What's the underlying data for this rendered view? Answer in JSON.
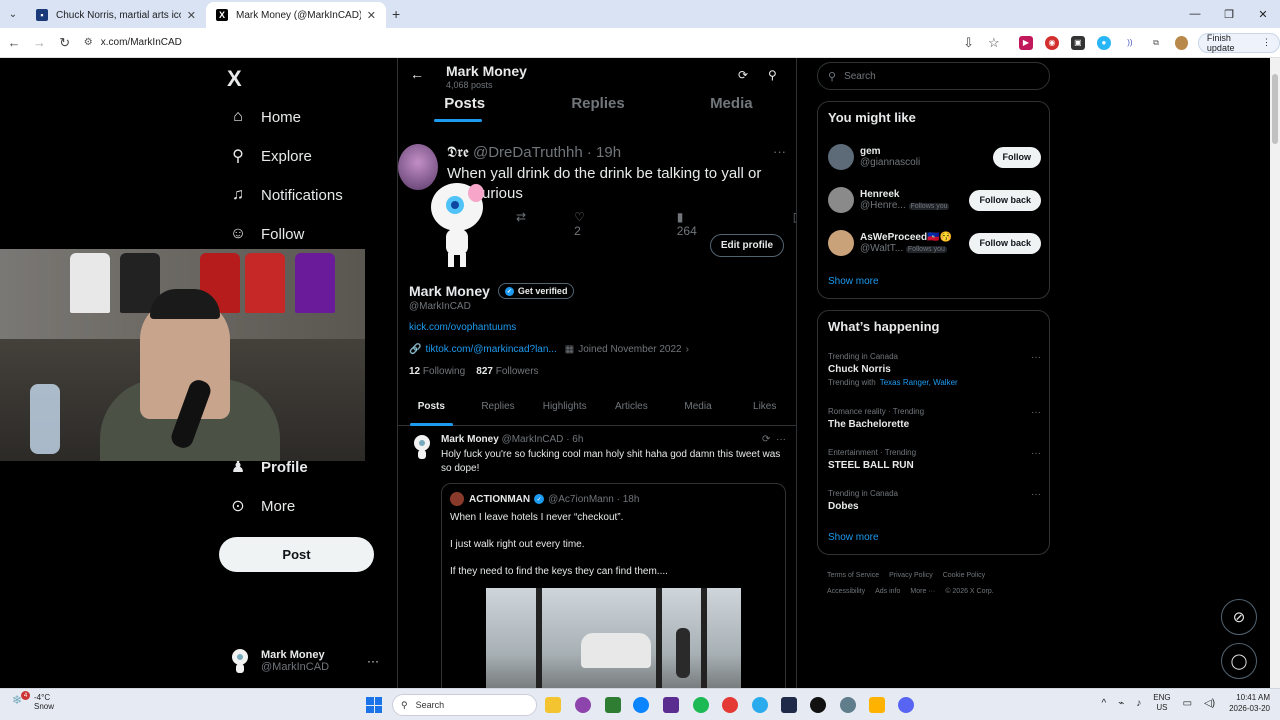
{
  "browser": {
    "tabs": [
      {
        "title": "Chuck Norris, martial arts icon a",
        "active": false
      },
      {
        "title": "Mark Money (@MarkInCAD) / X",
        "active": true
      }
    ],
    "url": "x.com/MarkInCAD",
    "finish_update": "Finish update"
  },
  "sidebar": {
    "logo": "X",
    "items": [
      {
        "label": "Home",
        "icon": "home-icon"
      },
      {
        "label": "Explore",
        "icon": "search-icon"
      },
      {
        "label": "Notifications",
        "icon": "bell-icon"
      },
      {
        "label": "Follow",
        "icon": "add-user-icon"
      },
      {
        "label": "Profile",
        "icon": "person-icon"
      },
      {
        "label": "More",
        "icon": "more-circle-icon"
      }
    ],
    "post_button": "Post",
    "account": {
      "name": "Mark Money",
      "handle": "@MarkInCAD"
    }
  },
  "feed": {
    "header": {
      "name": "Mark Money",
      "post_count": "4,068 posts"
    },
    "tabs": [
      "Posts",
      "Replies",
      "Media"
    ],
    "overlay_tweet": {
      "name": "𝕯𝖗𝖊",
      "handle": "@DreDaTruthhh",
      "time": "· 19h",
      "text": "When yall drink do the drink be talking to yall or   just curious",
      "likes": "2",
      "views": "264"
    },
    "profile": {
      "edit_button": "Edit profile",
      "name": "Mark Money",
      "verify_label": "Get verified",
      "handle": "@MarkInCAD",
      "link1": "kick.com/ovophantuums",
      "link2": "tiktok.com/@markincad?lan...",
      "joined": "Joined November 2022",
      "following_count": "12",
      "following_label": "Following",
      "followers_count": "827",
      "followers_label": "Followers"
    },
    "subtabs": [
      "Posts",
      "Replies",
      "Highlights",
      "Articles",
      "Media",
      "Likes"
    ],
    "tweet": {
      "name": "Mark Money",
      "handle": "@MarkInCAD",
      "time": "· 6h",
      "text": "Holy fuck you're so fucking cool man holy shit haha god damn this tweet was so dope!",
      "quote": {
        "name": "ACTIONMAN",
        "handle": "@Ac7ionMann",
        "time": "· 18h",
        "line1": "When I leave hotels I never “checkout”.",
        "line2": "I just walk right out every time.",
        "line3": "If they need to find the keys they can find them...."
      }
    }
  },
  "right": {
    "search_placeholder": "Search",
    "you_might_like": {
      "title": "You might like",
      "users": [
        {
          "name": "gem",
          "handle": "@giannascoli",
          "follows_you": "",
          "button": "Follow"
        },
        {
          "name": "Henreek",
          "handle": "@Henre...",
          "follows_you": "Follows you",
          "button": "Follow back"
        },
        {
          "name": "AsWeProceed🇭🇹😚",
          "handle": "@WaltT...",
          "follows_you": "Follows you",
          "button": "Follow back"
        }
      ],
      "show_more": "Show more"
    },
    "whats_happening": {
      "title": "What’s happening",
      "trends": [
        {
          "context": "Trending in Canada",
          "title": "Chuck Norris",
          "sub": "Trending with",
          "sub_links": "Texas Ranger, Walker"
        },
        {
          "context": "Romance reality · Trending",
          "title": "The Bachelorette",
          "sub": "",
          "sub_links": ""
        },
        {
          "context": "Entertainment · Trending",
          "title": "STEEL BALL RUN",
          "sub": "",
          "sub_links": ""
        },
        {
          "context": "Trending in Canada",
          "title": "Dobes",
          "sub": "",
          "sub_links": ""
        }
      ],
      "show_more": "Show more"
    },
    "footer": {
      "tos": "Terms of Service",
      "privacy": "Privacy Policy",
      "cookie": "Cookie Policy",
      "accessibility": "Accessibility",
      "ads": "Ads info",
      "more": "More ···",
      "copyright": "© 2026 X Corp."
    }
  },
  "taskbar": {
    "weather_temp": "-4°C",
    "weather_desc": "Snow",
    "weather_badge": "4",
    "search": "Search",
    "lang1": "ENG",
    "lang2": "US",
    "time": "10:41 AM",
    "date": "2026-03-20"
  },
  "colors": {
    "accent": "#1d9bf0",
    "background": "#000000"
  }
}
